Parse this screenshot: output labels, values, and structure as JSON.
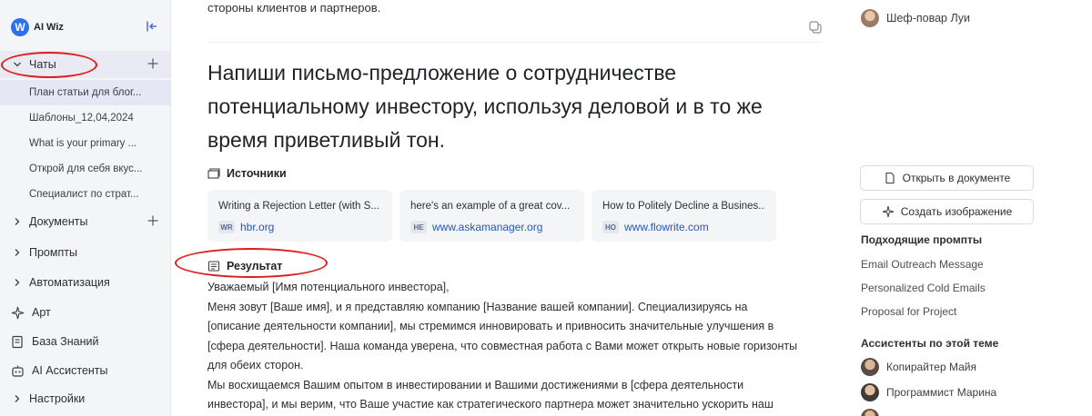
{
  "sidebar": {
    "logo_letter": "W",
    "logo_text": "AI Wiz",
    "chats_label": "Чаты",
    "chat_items": [
      "План статьи для блог...",
      "Шаблоны_12,04,2024",
      "What is your primary ...",
      "Открой для себя вкус...",
      "Специалист по страт..."
    ],
    "documents_label": "Документы",
    "prompts_label": "Промпты",
    "automation_label": "Автоматизация",
    "art_label": "Арт",
    "knowledge_label": "База Знаний",
    "assistants_label": "AI Ассистенты",
    "settings_label": "Настройки"
  },
  "main": {
    "top_text": "стороны клиентов и партнеров.",
    "question": "Напиши письмо-предложение о сотрудничестве потенциальному инвестору, используя деловой и в то же время приветливый тон.",
    "sources_label": "Источники",
    "sources": [
      {
        "title": "Writing a Rejection Letter (with S...",
        "badge": "WR",
        "domain": "hbr.org"
      },
      {
        "title": "here's an example of a great cov...",
        "badge": "HE",
        "domain": "www.askamanager.org"
      },
      {
        "title": "How to Politely Decline a Busines...",
        "badge": "HO",
        "domain": "www.flowrite.com"
      }
    ],
    "result_label": "Результат",
    "result_lines": [
      "Уважаемый [Имя потенциального инвестора],",
      "Меня зовут [Ваше имя], и я представляю компанию [Название вашей компании]. Специализируясь на",
      "[описание деятельности компании], мы стремимся инновировать и привносить значительные улучшения в",
      "[сфера деятельности]. Наша команда уверена, что совместная работа с Вами может открыть новые горизонты",
      "для обеих сторон.",
      "Мы восхищаемся Вашим опытом в инвестировании и Вашими достижениями в [сфера деятельности",
      "инвестора], и мы верим, что Ваше участие как стратегического партнера может значительно ускорить наш"
    ]
  },
  "right": {
    "chef_name": "Шеф-повар Луи",
    "open_doc_label": "Открыть в документе",
    "create_image_label": "Создать изображение",
    "prompts_heading": "Подходящие промпты",
    "prompts": [
      "Email Outreach Message",
      "Personalized Cold Emails",
      "Proposal for Project"
    ],
    "assistants_heading": "Ассистенты по этой теме",
    "assistants": [
      "Копирайтер Майя",
      "Программист Марина"
    ]
  },
  "colors": {
    "accent": "#2f6fed",
    "annotation": "#e01b1b",
    "link": "#2057c7"
  }
}
